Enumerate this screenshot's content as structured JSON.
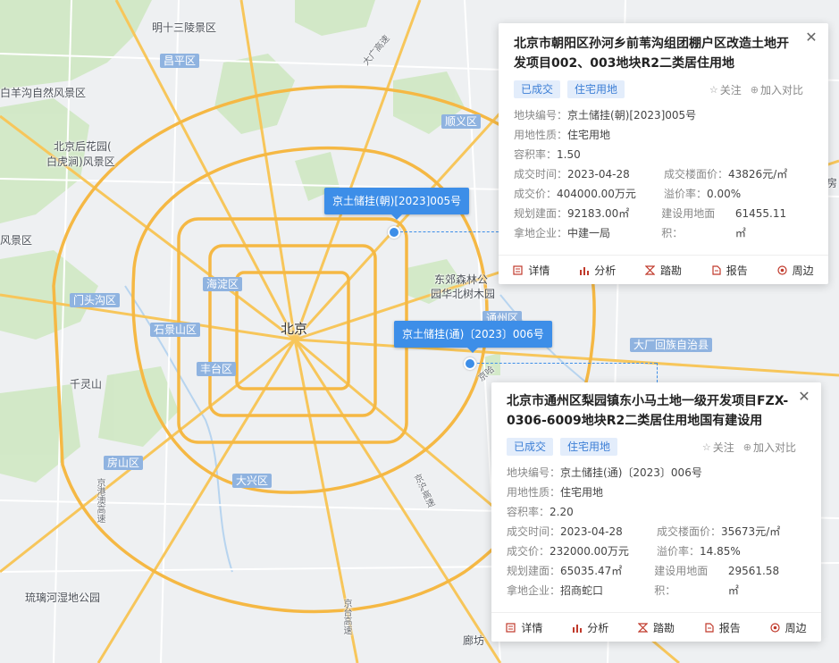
{
  "map": {
    "labels": {
      "ming_tombs": "明十三陵景区",
      "changping": "昌平区",
      "yangfang": "白羊沟自然风景区",
      "houhuayuan": "北京后花园(",
      "baihuxian": "白虎涧)风景区",
      "fengjingqu": "风景区",
      "shunyi": "顺义区",
      "dongjiao": "东郊森林公",
      "yuanhuabei": "园华北树木园",
      "mentougou": "门头沟区",
      "haidian": "海淀区",
      "beijing": "北京",
      "shijingshan": "石景山区",
      "fengtai": "丰台区",
      "qianlingshan": "千灵山",
      "tongzhou": "通州区",
      "dachang": "大厂回族自治县",
      "fangshan": "房山区",
      "daxing": "大兴区",
      "liulihe": "琉璃河湿地公园",
      "langfang": "廊坊",
      "daguang": "大广高速",
      "jinggang": "京港澳高速",
      "jingtai": "京台高速",
      "jinghu": "京沪高速",
      "jingha": "京哈",
      "fangshan_b": "房"
    },
    "pins": [
      {
        "label": "京土储挂(朝)[2023]005号"
      },
      {
        "label": "京土储挂(通)〔2023〕006号"
      }
    ]
  },
  "cards": [
    {
      "title": "北京市朝阳区孙河乡前苇沟组团棚户区改造土地开发项目002、003地块R2二类居住用地",
      "tags": [
        "已成交",
        "住宅用地"
      ],
      "follow": "关注",
      "compare": "加入对比",
      "rows": [
        {
          "k": "地块编号：",
          "v": "京土储挂(朝)[2023]005号"
        },
        {
          "k": "用地性质：",
          "v": "住宅用地"
        },
        {
          "k": "容积率：",
          "v": "1.50"
        }
      ],
      "pairs": [
        [
          {
            "k": "成交时间：",
            "v": "2023-04-28"
          },
          {
            "k": "成交楼面价：",
            "v": "43826元/㎡"
          }
        ],
        [
          {
            "k": "成交价：",
            "v": "404000.00万元"
          },
          {
            "k": "溢价率：",
            "v": "0.00%"
          }
        ],
        [
          {
            "k": "规划建面：",
            "v": "92183.00㎡"
          },
          {
            "k": "建设用地面积：",
            "v": "61455.11㎡"
          }
        ]
      ],
      "buyer": {
        "k": "拿地企业：",
        "v": "中建一局"
      },
      "footer": [
        "详情",
        "分析",
        "踏勘",
        "报告",
        "周边"
      ]
    },
    {
      "title": "北京市通州区梨园镇东小马土地一级开发项目FZX-0306-6009地块R2二类居住用地国有建设用地...",
      "tags": [
        "已成交",
        "住宅用地"
      ],
      "follow": "关注",
      "compare": "加入对比",
      "rows": [
        {
          "k": "地块编号：",
          "v": "京土储挂(通)〔2023〕006号"
        },
        {
          "k": "用地性质：",
          "v": "住宅用地"
        },
        {
          "k": "容积率：",
          "v": "2.20"
        }
      ],
      "pairs": [
        [
          {
            "k": "成交时间：",
            "v": "2023-04-28"
          },
          {
            "k": "成交楼面价：",
            "v": "35673元/㎡"
          }
        ],
        [
          {
            "k": "成交价：",
            "v": "232000.00万元"
          },
          {
            "k": "溢价率：",
            "v": "14.85%"
          }
        ],
        [
          {
            "k": "规划建面：",
            "v": "65035.47㎡"
          },
          {
            "k": "建设用地面积：",
            "v": "29561.58㎡"
          }
        ]
      ],
      "buyer": {
        "k": "拿地企业：",
        "v": "招商蛇口"
      },
      "footer": [
        "详情",
        "分析",
        "踏勘",
        "报告",
        "周边"
      ]
    }
  ]
}
